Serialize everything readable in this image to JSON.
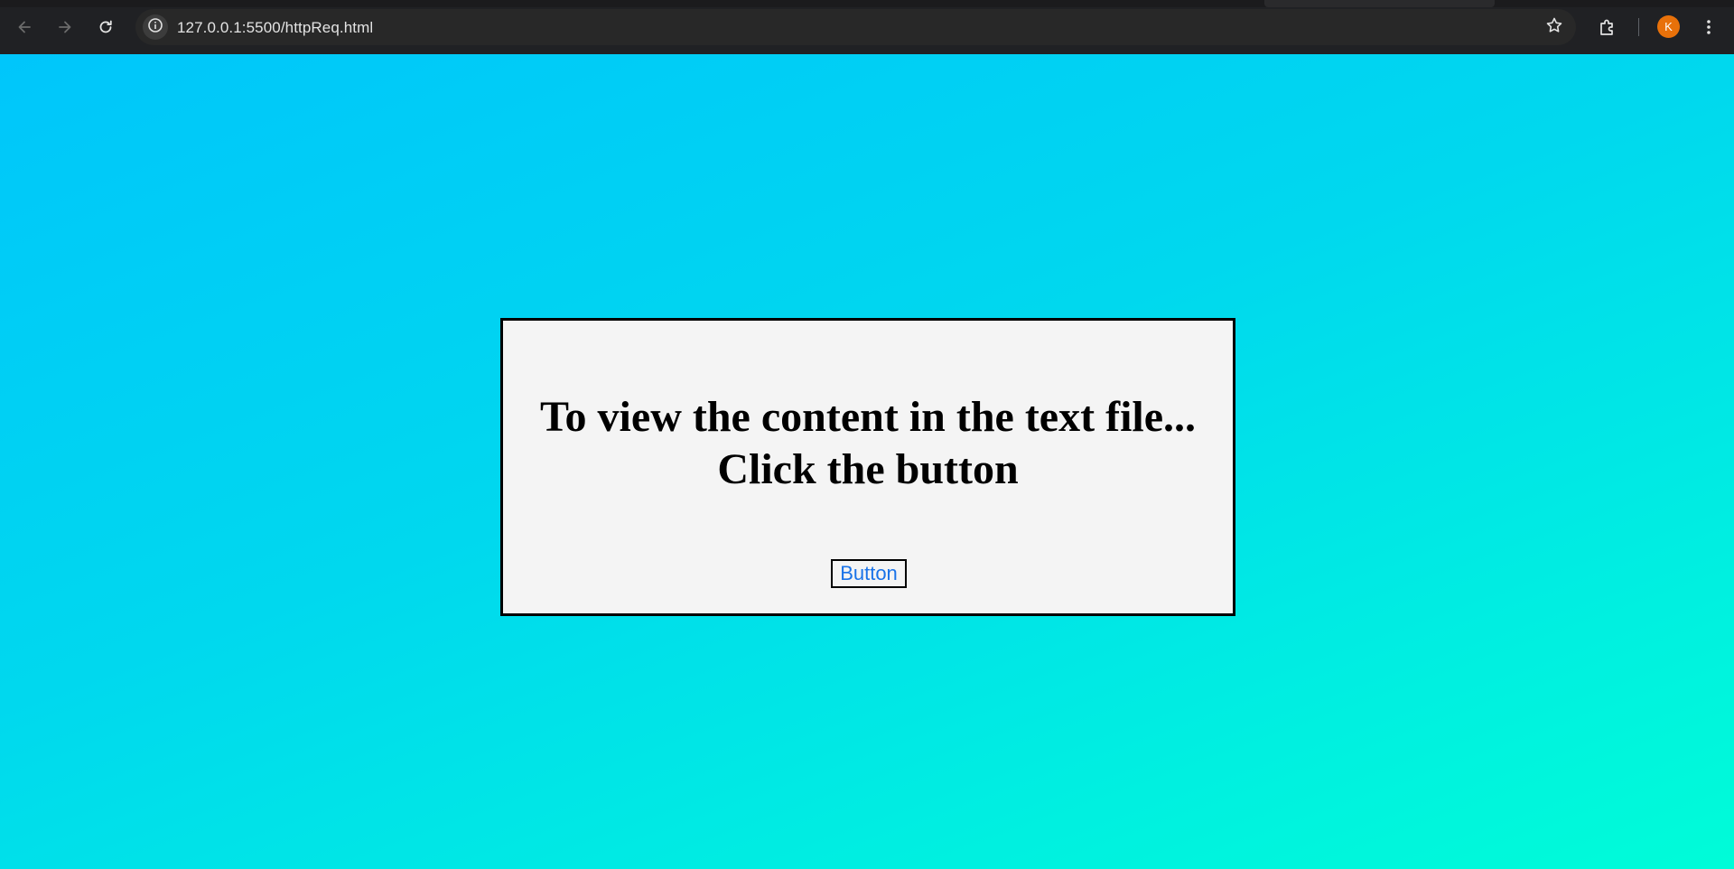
{
  "browser": {
    "url": "127.0.0.1:5500/httpReq.html",
    "profile_initial": "K",
    "icons": {
      "back": "arrow-left-icon",
      "forward": "arrow-right-icon",
      "reload": "reload-icon",
      "site_info": "info-icon",
      "bookmark": "star-icon",
      "extensions": "puzzle-icon",
      "menu": "kebab-menu-icon"
    }
  },
  "page": {
    "heading_line1": "To view the content in the text file...",
    "heading_line2": "Click the button",
    "button_label": "Button"
  },
  "colors": {
    "gradient_start": "#00c6fb",
    "gradient_end": "#00fcd8",
    "card_background": "#f4f4f4",
    "button_text": "#1a73e8",
    "avatar": "#e8710a"
  }
}
